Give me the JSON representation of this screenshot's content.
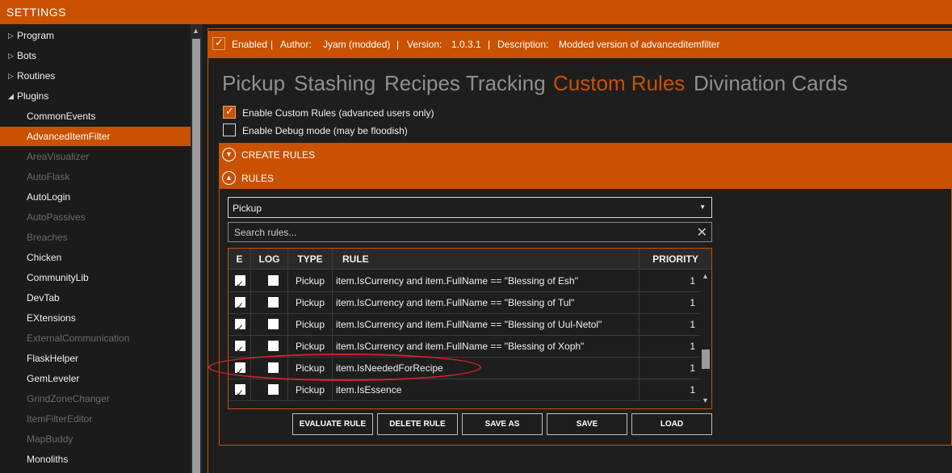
{
  "window": {
    "title": "SETTINGS"
  },
  "sidebar": {
    "items": [
      {
        "label": "Program",
        "expandable": true,
        "icon": "chevron-right-icon"
      },
      {
        "label": "Bots",
        "expandable": true,
        "icon": "chevron-right-icon"
      },
      {
        "label": "Routines",
        "expandable": true,
        "icon": "chevron-right-icon"
      },
      {
        "label": "Plugins",
        "expandable": true,
        "expanded": true,
        "icon": "chevron-down-icon"
      }
    ],
    "plugins": [
      {
        "label": "CommonEvents",
        "enabled": true
      },
      {
        "label": "AdvancedItemFilter",
        "enabled": true,
        "selected": true
      },
      {
        "label": "AreaVisualizer",
        "enabled": false
      },
      {
        "label": "AutoFlask",
        "enabled": false
      },
      {
        "label": "AutoLogin",
        "enabled": true
      },
      {
        "label": "AutoPassives",
        "enabled": false
      },
      {
        "label": "Breaches",
        "enabled": false
      },
      {
        "label": "Chicken",
        "enabled": true
      },
      {
        "label": "CommunityLib",
        "enabled": true
      },
      {
        "label": "DevTab",
        "enabled": true
      },
      {
        "label": "EXtensions",
        "enabled": true
      },
      {
        "label": "ExternalCommunication",
        "enabled": false
      },
      {
        "label": "FlaskHelper",
        "enabled": true
      },
      {
        "label": "GemLeveler",
        "enabled": true
      },
      {
        "label": "GrindZoneChanger",
        "enabled": false
      },
      {
        "label": "ItemFilterEditor",
        "enabled": false
      },
      {
        "label": "MapBuddy",
        "enabled": false
      },
      {
        "label": "Monoliths",
        "enabled": true
      }
    ]
  },
  "info": {
    "enabled_label": "Enabled",
    "enabled_checked": true,
    "author_label": "Author:",
    "author": "Jyam (modded)",
    "version_label": "Version:",
    "version": "1.0.3.1",
    "description_label": "Description:",
    "description": "Modded version of advanceditemfilter",
    "separator": "|"
  },
  "tabs": [
    {
      "label": "Pickup",
      "active": false
    },
    {
      "label": "Stashing",
      "active": false
    },
    {
      "label": "Recipes",
      "active": false
    },
    {
      "label": "Tracking",
      "active": false
    },
    {
      "label": "Custom Rules",
      "active": true
    },
    {
      "label": "Divination Cards",
      "active": false
    }
  ],
  "options": {
    "custom_rules": {
      "label": "Enable Custom Rules (advanced users only)",
      "checked": true
    },
    "debug": {
      "label": "Enable Debug mode (may be floodish)",
      "checked": false
    }
  },
  "sections": {
    "create_rules": {
      "label": "CREATE RULES",
      "icon": "chevron-down-circle-icon"
    },
    "rules": {
      "label": "RULES",
      "icon": "chevron-up-circle-icon"
    }
  },
  "rule_type": {
    "selected": "Pickup"
  },
  "search": {
    "placeholder": "Search rules...",
    "value": ""
  },
  "grid": {
    "columns": [
      "E",
      "LOG",
      "TYPE",
      "RULE",
      "PRIORITY"
    ],
    "rows": [
      {
        "enabled": true,
        "log": false,
        "type": "Pickup",
        "rule": "item.IsCurrency and item.FullName == \"Blessing of Esh\"",
        "priority": "1"
      },
      {
        "enabled": true,
        "log": false,
        "type": "Pickup",
        "rule": "item.IsCurrency and item.FullName == \"Blessing of Tul\"",
        "priority": "1"
      },
      {
        "enabled": true,
        "log": false,
        "type": "Pickup",
        "rule": "item.IsCurrency and item.FullName == \"Blessing of Uul-Netol\"",
        "priority": "1"
      },
      {
        "enabled": true,
        "log": false,
        "type": "Pickup",
        "rule": "item.IsCurrency and item.FullName == \"Blessing of Xoph\"",
        "priority": "1"
      },
      {
        "enabled": true,
        "log": false,
        "type": "Pickup",
        "rule": "item.IsNeededForRecipe",
        "priority": "1",
        "highlighted": true
      },
      {
        "enabled": true,
        "log": false,
        "type": "Pickup",
        "rule": "item.IsEssence",
        "priority": "1"
      }
    ]
  },
  "buttons": {
    "evaluate": "EVALUATE RULE",
    "delete": "DELETE RULE",
    "save_as": "SAVE AS",
    "save": "SAVE",
    "load": "LOAD"
  },
  "colors": {
    "accent": "#ca5100",
    "background": "#1e1e1e",
    "annotation": "#d6202c"
  }
}
